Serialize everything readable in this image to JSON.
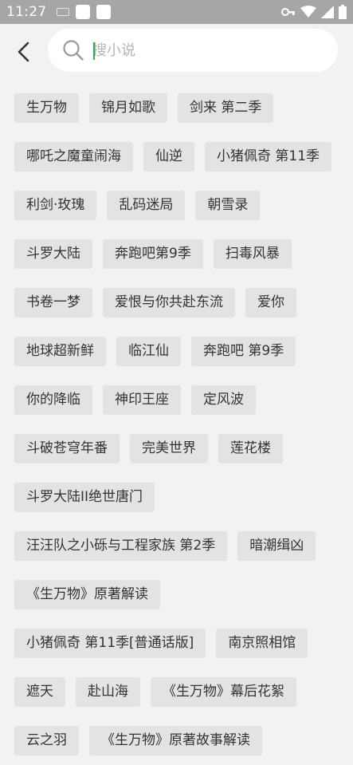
{
  "status_bar": {
    "time": "11:27",
    "icons": [
      "keyboard-icon",
      "notification-square-icon",
      "notification-square-icon",
      "vpn-key-icon",
      "wifi-icon",
      "cell-signal-icon",
      "battery-icon"
    ]
  },
  "search": {
    "placeholder": "搜小说",
    "value": "",
    "accent_color": "#2eae4f"
  },
  "tag_rows": [
    [
      "生万物",
      "锦月如歌",
      "剑来 第二季"
    ],
    [
      "哪吒之魔童闹海",
      "仙逆",
      "小猪佩奇 第11季"
    ],
    [
      "利剑·玫瑰",
      "乱码迷局",
      "朝雪录"
    ],
    [
      "斗罗大陆",
      "奔跑吧第9季",
      "扫毒风暴"
    ],
    [
      "书卷一梦",
      "爱恨与你共赴东流",
      "爱你"
    ],
    [
      "地球超新鲜",
      "临江仙",
      "奔跑吧 第9季"
    ],
    [
      "你的降临",
      "神印王座",
      "定风波"
    ],
    [
      "斗破苍穹年番",
      "完美世界",
      "莲花楼"
    ],
    [
      "斗罗大陆II绝世唐门"
    ],
    [
      "汪汪队之小砾与工程家族 第2季",
      "暗潮缉凶"
    ],
    [
      "《生万物》原著解读"
    ],
    [
      "小猪佩奇 第11季[普通话版]",
      "南京照相馆"
    ],
    [
      "遮天",
      "赴山海",
      "《生万物》幕后花絮"
    ],
    [
      "云之羽",
      "《生万物》原著故事解读"
    ]
  ]
}
